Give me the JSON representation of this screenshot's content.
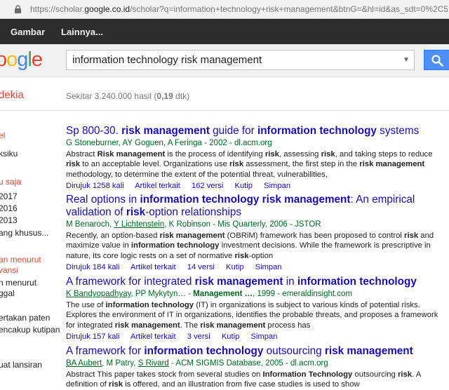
{
  "browser": {
    "url_prefix": "https://scholar.",
    "url_domain": "google.co.id",
    "url_rest": "/scholar?q=information+technology+risk+management&btnG=&hl=id&as_sdt=0%2C5&as_vis=1"
  },
  "gbar": {
    "item1": "Gambar",
    "item2": "Lainnya..."
  },
  "search": {
    "query": "information technology risk management",
    "logo": "oogle",
    "brand": "dekia"
  },
  "stats": {
    "prefix": "Sekitar 3.240.000 hasil (",
    "time": "0,19",
    "suffix": " dtk)"
  },
  "sidebar": [
    "el",
    "ksiku",
    "u saja",
    " 2017",
    " 2016",
    " 2013",
    "ang khusus...",
    "an menurut",
    "vansi",
    "n menurut",
    "ggal",
    "ertakan paten",
    "encakup kutipan",
    "uat lansiran"
  ],
  "results": [
    {
      "title": "Sp 800-30. risk management guide for information technology systems",
      "authors": "G Stoneburner, AY Goguen, A Feringa - 2002 - dl.acm.org",
      "snippet": "Abstract Risk management is the process of identifying risk, assessing risk, and taking steps to reduce risk to an acceptable level. Organizations use risk assessment, the first step in the risk management methodology, to determine the extent of the potential threat, vulnerabilities,",
      "links": [
        "Dirujuk 1258 kali",
        "Artikel terkait",
        "162 versi",
        "Kutip",
        "Simpan"
      ]
    },
    {
      "title": "Real options in information technology risk management: An empirical validation of risk-option relationships",
      "authors": "M Benaroch, Y Lichtenstein, K Robinson - Mis Quarterly, 2006 - JSTOR",
      "snippet": "Recently, an option-based risk management (OBRiM) framework has been proposed to control risk and maximize value in information technology investment decisions. While the framework is prescriptive in nature, its core logic rests on a set of normative risk-option",
      "links": [
        "Dirujuk 184 kali",
        "Artikel terkait",
        "14 versi",
        "Kutip",
        "Simpan"
      ]
    },
    {
      "title": "A framework for integrated risk management in information technology",
      "authors": "K Bandyopadhyay, PP Mykytyn… - Management …, 1999 - emeraldinsight.com",
      "snippet": "The use of information technology (IT) in organizations is subject to various kinds of potential risks. Explores the environment of IT in organizations, identifies the probable threats, and proposes a framework for integrated risk management. The risk management process has",
      "links": [
        "Dirujuk 157 kali",
        "Artikel terkait",
        "3 versi",
        "Kutip",
        "Simpan"
      ]
    },
    {
      "title": "A framework for information technology outsourcing risk management",
      "authors": "BA Aubert, M Patry, S Rivard - ACM SIGMIS Database, 2005 - dl.acm.org",
      "snippet": "Abstract This paper takes stock from several studies on Information Technology outsourcing risk. A definition of risk is offered, and an illustration from five case studies is used to show",
      "links": []
    }
  ]
}
